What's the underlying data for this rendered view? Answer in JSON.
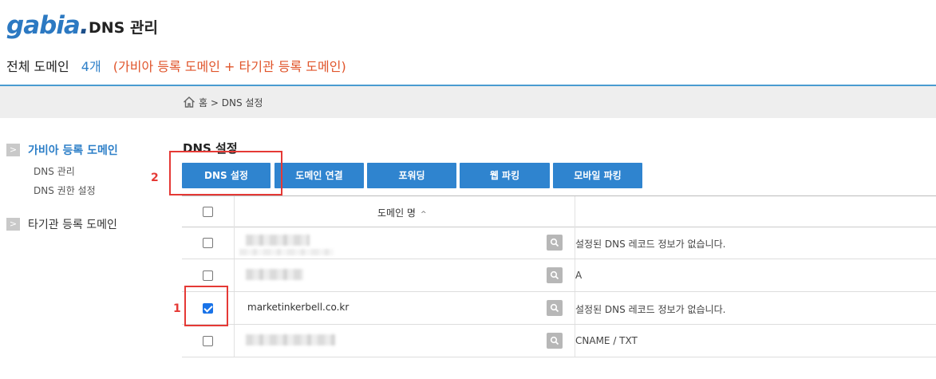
{
  "header": {
    "logo": "gabia",
    "logo_dot": ".",
    "title": "DNS 관리"
  },
  "summary": {
    "label": "전체 도메인",
    "count": "4개",
    "note": "(가비아 등록 도메인 + 타기관 등록 도메인)"
  },
  "breadcrumb": {
    "text": "홈 > DNS 설정"
  },
  "sidebar": {
    "groups": [
      {
        "label": "가비아 등록 도메인",
        "arrow": ">"
      },
      {
        "label": "타기관 등록 도메인",
        "arrow": ">"
      }
    ],
    "subitems": [
      "DNS 관리",
      "DNS 권한 설정"
    ]
  },
  "section": {
    "title": "DNS 설정"
  },
  "tabs": [
    "DNS 설정",
    "도메인 연결",
    "포워딩",
    "웹 파킹",
    "모바일 파킹"
  ],
  "annotations": [
    "2",
    "1"
  ],
  "table": {
    "header_domain": "도메인 명",
    "sort_glyph": "^",
    "rows": [
      {
        "domain": "",
        "checked": false,
        "record": "설정된 DNS 레코드 정보가 없습니다."
      },
      {
        "domain": "",
        "checked": false,
        "record": "A"
      },
      {
        "domain": "marketinkerbell.co.kr",
        "checked": true,
        "record": "설정된 DNS 레코드 정보가 없습니다."
      },
      {
        "domain": "",
        "checked": false,
        "record": "CNAME / TXT"
      }
    ]
  },
  "colors": {
    "accent": "#2f84cf",
    "link": "#2d7fc8",
    "note": "#e0542a",
    "highlight": "#e53935"
  }
}
